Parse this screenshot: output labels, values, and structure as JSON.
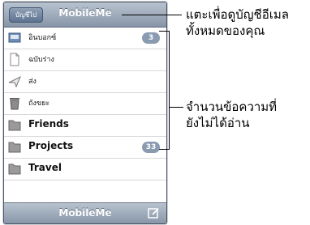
{
  "nav": {
    "back_label": "บัญชีไป",
    "title": "MobileMe"
  },
  "mailboxes": [
    {
      "label": "อินบอกซ์",
      "badge": "3",
      "icon": "inbox-icon"
    },
    {
      "label": "ฉบับร่าง",
      "badge": "",
      "icon": "drafts-icon"
    },
    {
      "label": "ส่ง",
      "badge": "",
      "icon": "sent-icon"
    },
    {
      "label": "ถังขยะ",
      "badge": "",
      "icon": "trash-icon"
    },
    {
      "label": "Friends",
      "badge": "",
      "icon": "folder-icon"
    },
    {
      "label": "Projects",
      "badge": "33",
      "icon": "folder-icon"
    },
    {
      "label": "Travel",
      "badge": "",
      "icon": "folder-icon"
    }
  ],
  "toolbar": {
    "title": "MobileMe",
    "compose_icon": "compose-icon"
  },
  "callouts": {
    "accounts_line1": "แตะเพื่อดูบัญชีอีเมล",
    "accounts_line2": "ทั้งหมดของคุณ",
    "unread_line1": "จำนวนข้อความที่",
    "unread_line2": "ยังไม่ได้อ่าน"
  }
}
